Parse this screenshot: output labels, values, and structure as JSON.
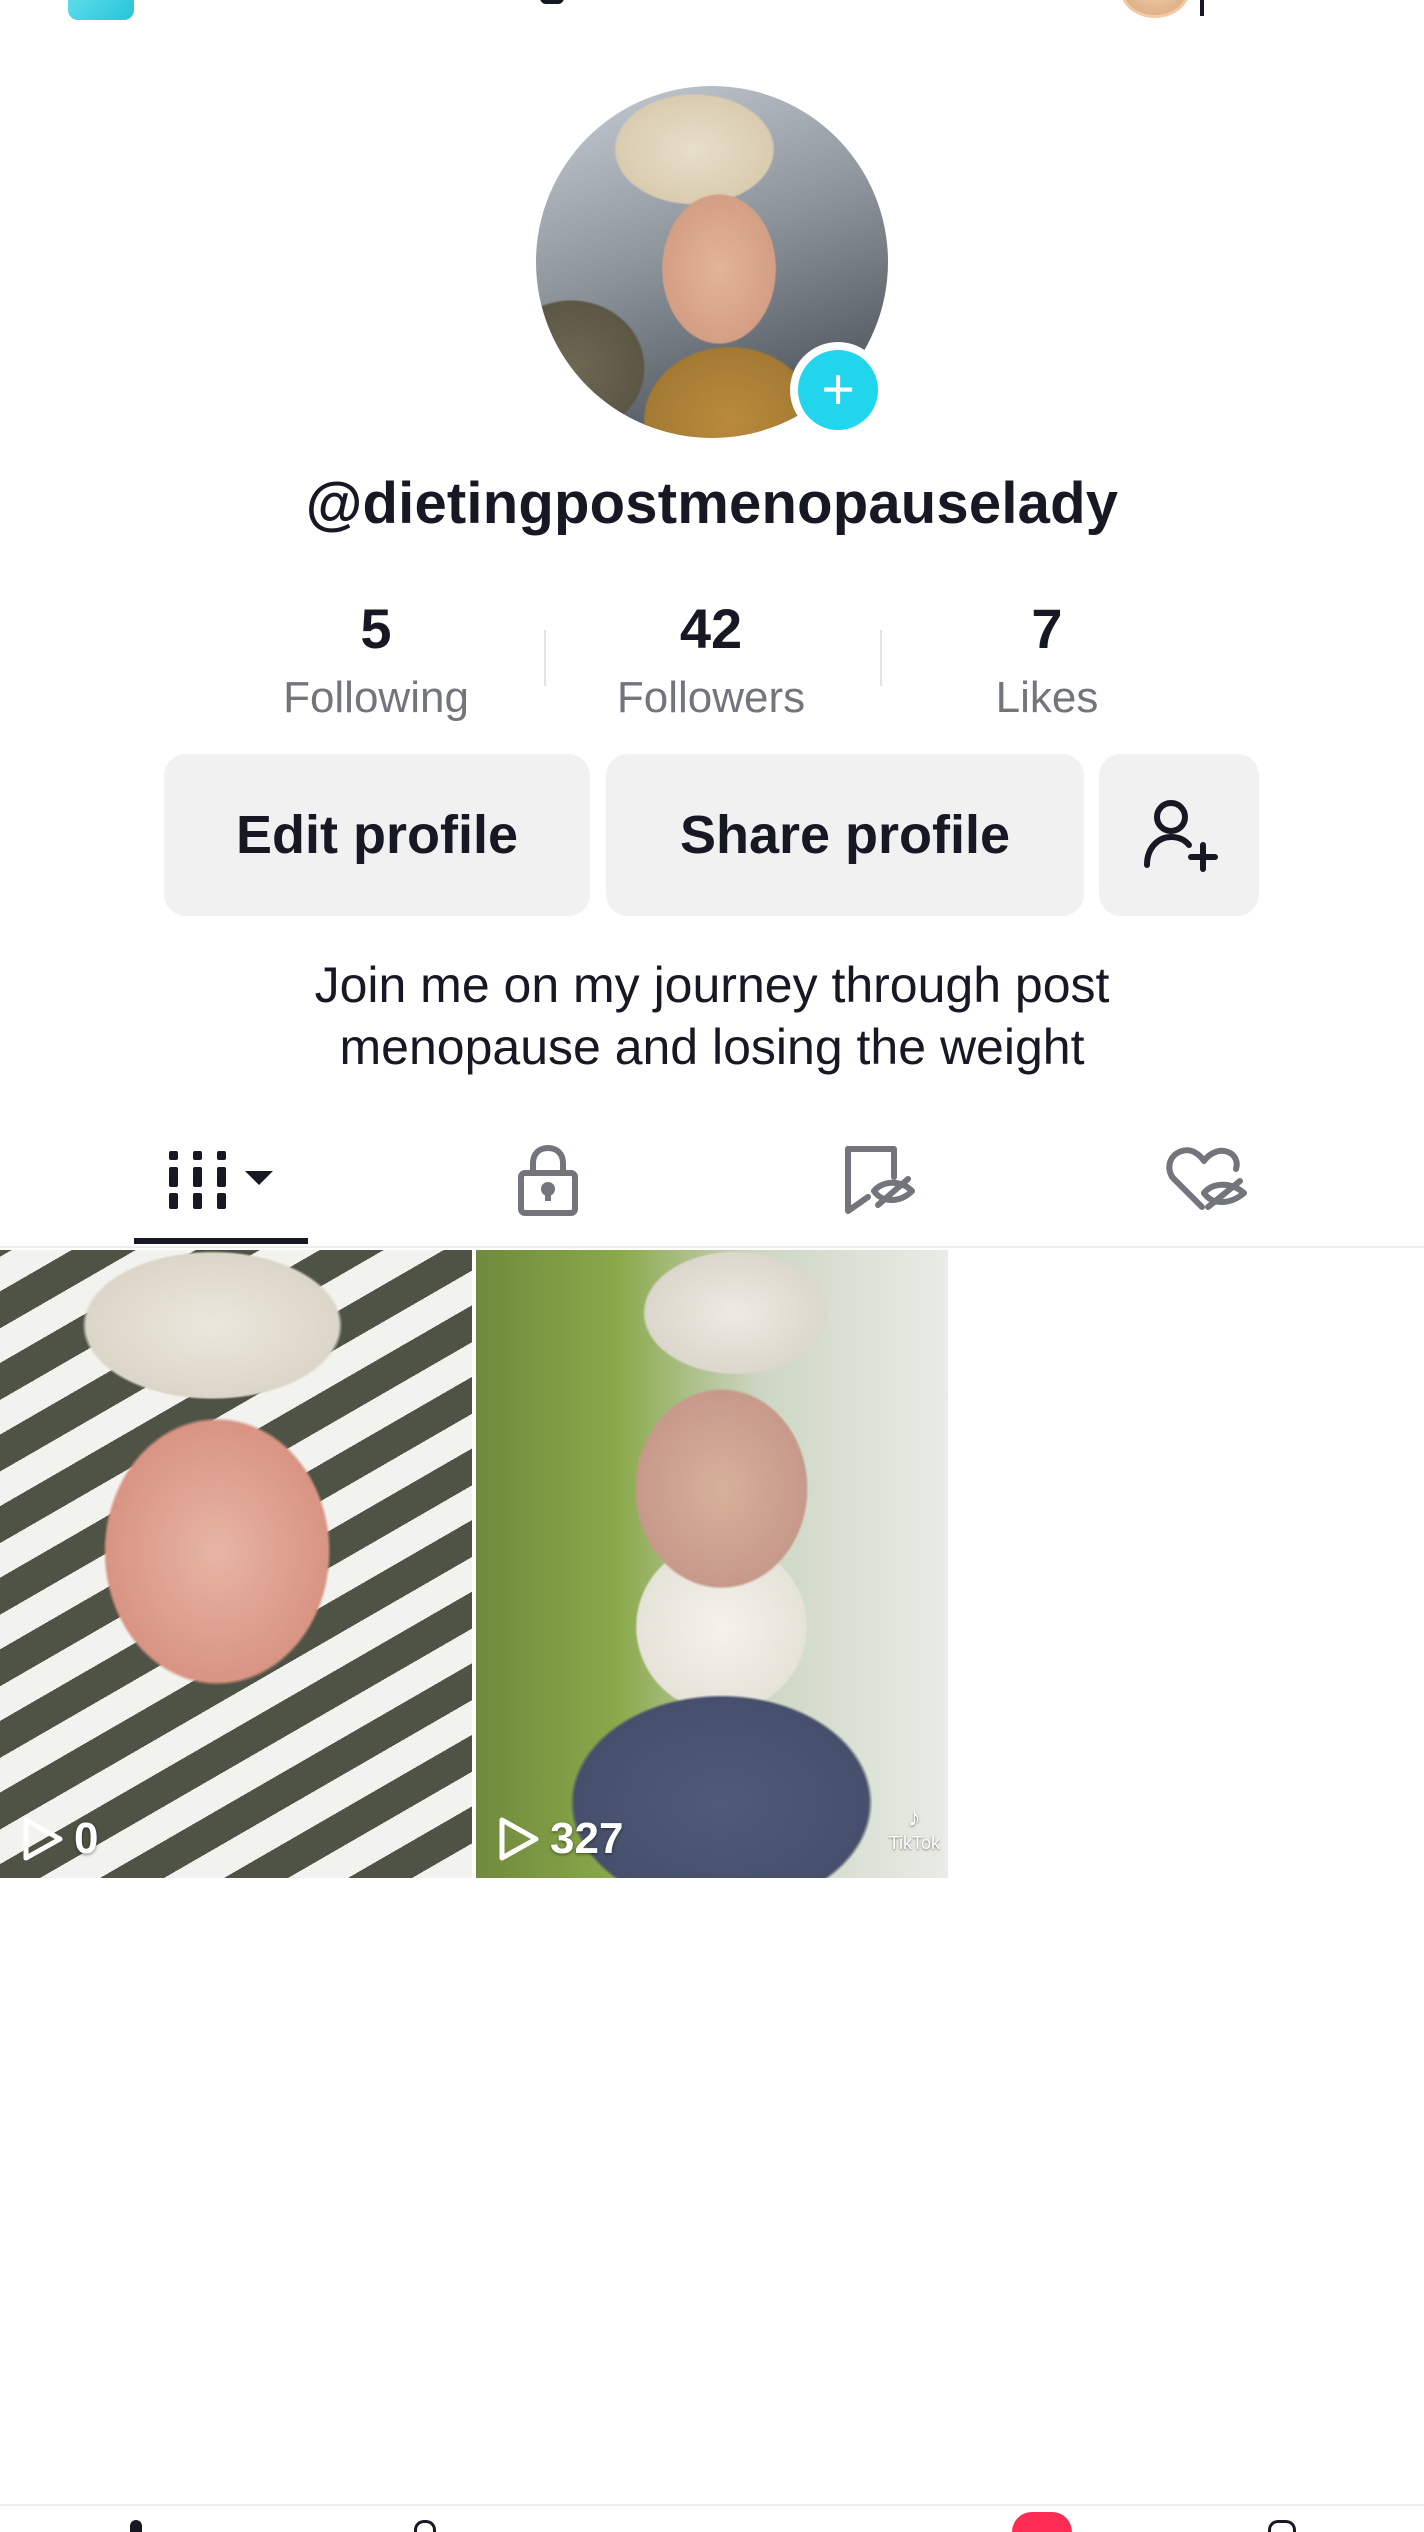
{
  "profile": {
    "username": "@dietingpostmenopauselady",
    "avatar_badge": "+",
    "bio": "Join me on my journey through post menopause and losing the weight"
  },
  "stats": {
    "following": {
      "value": "5",
      "label": "Following"
    },
    "followers": {
      "value": "42",
      "label": "Followers"
    },
    "likes": {
      "value": "7",
      "label": "Likes"
    }
  },
  "actions": {
    "edit_label": "Edit profile",
    "share_label": "Share profile",
    "add_friend_icon": "add-user-icon"
  },
  "tabs": [
    {
      "icon": "grid-icon",
      "active": true
    },
    {
      "icon": "lock-icon",
      "active": false
    },
    {
      "icon": "bookmark-hidden-icon",
      "active": false
    },
    {
      "icon": "heart-hidden-icon",
      "active": false
    }
  ],
  "videos": [
    {
      "views": "0"
    },
    {
      "views": "327",
      "watermark": "TikTok"
    }
  ],
  "colors": {
    "accent": "#20d5ec",
    "text": "#161823",
    "muted": "#73757c",
    "button_bg": "#f1f1f2",
    "brand_red": "#fe2c55"
  }
}
